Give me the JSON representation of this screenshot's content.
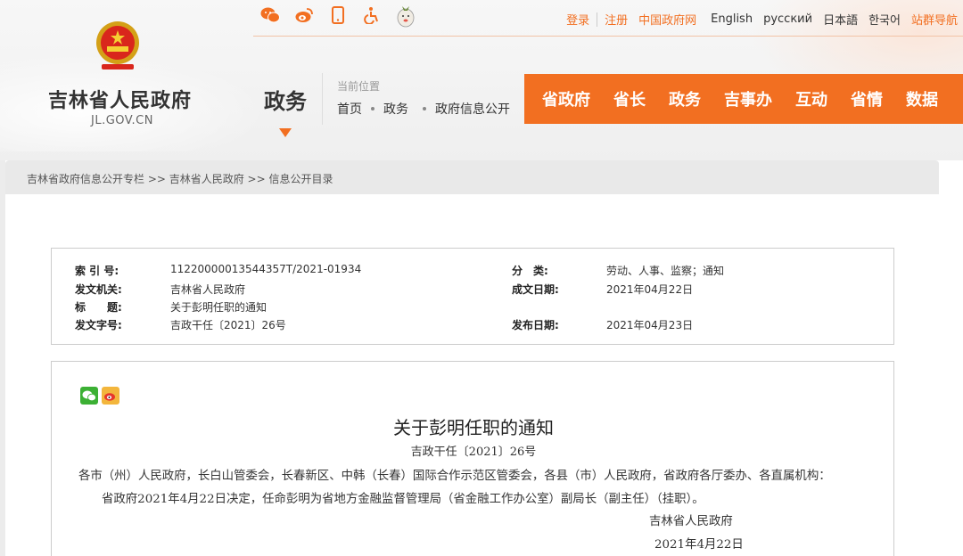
{
  "header": {
    "site_name": "吉林省人民政府",
    "domain": "JL.GOV.CN",
    "section": "政务",
    "location_label": "当前位置",
    "location_path": [
      "首页",
      "政务",
      "政府信息公开"
    ],
    "top_links": [
      "登录",
      "注册",
      "中国政府网",
      "English",
      "русский",
      "日本語",
      "한국어",
      "站群导航"
    ],
    "icons": [
      "wechat-icon",
      "weibo-icon",
      "mobile-icon",
      "accessibility-icon",
      "mascot-icon"
    ],
    "accent_color": "#f26f21"
  },
  "mainnav": {
    "items": [
      "省政府",
      "省长",
      "政务",
      "吉事办",
      "互动",
      "省情",
      "数据"
    ]
  },
  "breadcrumb": {
    "text": "吉林省政府信息公开专栏 >> 吉林省人民政府 >> 信息公开目录"
  },
  "meta": {
    "index_label": "索 引 号:",
    "index_value": "11220000013544357T/2021-01934",
    "issuer_label": "发文机关:",
    "issuer_value": "吉林省人民政府",
    "title_label": "标　　题:",
    "title_value": "关于彭明任职的通知",
    "docno_label": "发文字号:",
    "docno_value": "吉政干任〔2021〕26号",
    "category_label": "分　类:",
    "category_value": "劳动、人事、监察；通知",
    "created_label": "成文日期:",
    "created_value": "2021年04月22日",
    "published_label": "发布日期:",
    "published_value": "2021年04月23日"
  },
  "document": {
    "title": "关于彭明任职的通知",
    "number": "吉政干任〔2021〕26号",
    "recipients": "各市（州）人民政府，长白山管委会，长春新区、中韩（长春）国际合作示范区管委会，各县（市）人民政府，省政府各厅委办、各直属机构：",
    "body": "省政府2021年4月22日决定，任命彭明为省地方金融监督管理局（省金融工作办公室）副局长（副主任）（挂职）。",
    "signer": "吉林省人民政府",
    "date": "2021年4月22日"
  }
}
